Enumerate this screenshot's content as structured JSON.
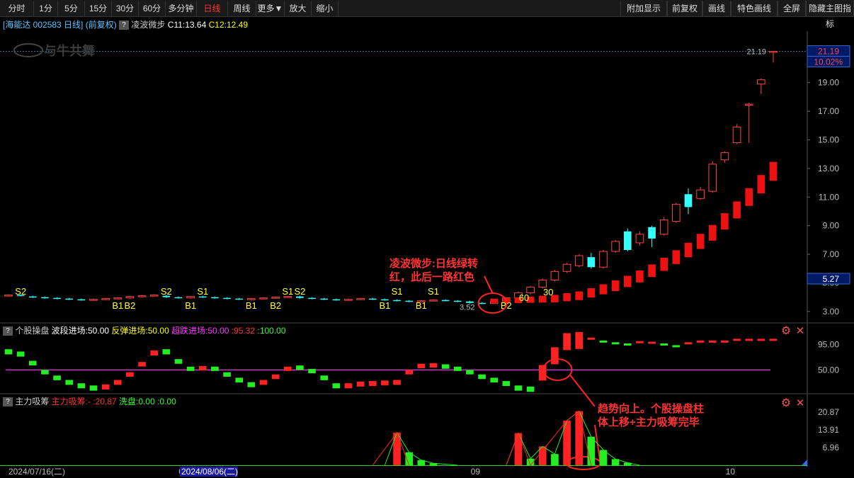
{
  "toolbar": {
    "left": [
      "分时",
      "1分",
      "5分",
      "15分",
      "30分",
      "60分",
      "多分钟",
      "日线",
      "周线",
      "更多▼",
      "放大",
      "缩小"
    ],
    "active": "日线",
    "right": [
      "附加显示",
      "前复权",
      "画线",
      "特色画线",
      "全屏",
      "隐藏主图指标"
    ]
  },
  "header": {
    "stock": "[海能达 002583 日线]",
    "adjust": "(前复权)",
    "indicator": "凌波微步",
    "c1": "C11:13.64",
    "c2": "C12:12.49"
  },
  "watermark": "与牛共舞",
  "panel2_header": {
    "name": "个股操盘",
    "items": [
      {
        "text": "波段进场:50.00",
        "color": "#ffffff"
      },
      {
        "text": "反弹进场:50.00",
        "color": "#ffff00"
      },
      {
        "text": "超跌进场:50.00",
        "color": "#ff33ff"
      },
      {
        "text": ":95.32",
        "color": "#ff3333"
      },
      {
        "text": ":100.00",
        "color": "#33ff33"
      }
    ]
  },
  "panel3_header": {
    "name": "主力吸筹",
    "items": [
      {
        "text": "主力吸筹:-",
        "color": "#ff3333"
      },
      {
        "text": ":20.87",
        "color": "#ff3333"
      },
      {
        "text": "洗盘:0.00",
        "color": "#33ff33"
      },
      {
        "text": ":0.00",
        "color": "#33ff33"
      }
    ]
  },
  "annotations": [
    {
      "text": "凌波微步:日线绿转",
      "color": "#ff3333"
    },
    {
      "text": "红，此后一路红色",
      "color": "#ff3333"
    },
    {
      "text": "趋势向上。个股操盘柱",
      "color": "#ff3333"
    },
    {
      "text": "体上移+主力吸筹完毕",
      "color": "#ff3333"
    }
  ],
  "signals": [
    "S2",
    "B1",
    "B2",
    "S2",
    "S1",
    "B1",
    "B1",
    "B2",
    "S1",
    "S2",
    "B1",
    "S1",
    "B1",
    "S1",
    "B2",
    "60",
    "30"
  ],
  "price_labels": {
    "high": "21.19",
    "low": "3.52",
    "last_tag": "21.19",
    "pct_tag": "10.02%",
    "ma_tag": "5.27"
  },
  "chart_data": {
    "type": "candlestick",
    "main": {
      "y_ticks": [
        "3.00",
        "5.00",
        "7.00",
        "9.00",
        "11.00",
        "13.00",
        "15.00",
        "17.00",
        "19.00",
        "21.00"
      ],
      "ylim": [
        2.2,
        22.6
      ],
      "candles": [
        [
          4.1,
          4.15,
          4.2,
          4.05
        ],
        [
          4.15,
          4.1,
          4.2,
          4.05
        ],
        [
          4.05,
          4.0,
          4.1,
          3.95
        ],
        [
          4.0,
          3.95,
          4.05,
          3.9
        ],
        [
          3.95,
          3.9,
          4.0,
          3.85
        ],
        [
          3.9,
          3.85,
          3.95,
          3.8
        ],
        [
          3.85,
          3.8,
          3.9,
          3.75
        ],
        [
          3.8,
          3.85,
          3.9,
          3.75
        ],
        [
          3.85,
          3.9,
          3.95,
          3.8
        ],
        [
          3.9,
          3.95,
          4.0,
          3.85
        ],
        [
          3.95,
          4.05,
          4.1,
          3.9
        ],
        [
          4.05,
          4.1,
          4.15,
          4.0
        ],
        [
          4.1,
          4.15,
          4.2,
          4.05
        ],
        [
          4.1,
          4.0,
          4.15,
          3.95
        ],
        [
          4.0,
          3.95,
          4.05,
          3.9
        ],
        [
          3.95,
          4.05,
          4.1,
          3.9
        ],
        [
          4.05,
          4.0,
          4.1,
          3.95
        ],
        [
          4.0,
          3.95,
          4.05,
          3.9
        ],
        [
          3.95,
          3.9,
          4.0,
          3.85
        ],
        [
          3.9,
          3.85,
          3.95,
          3.8
        ],
        [
          3.85,
          3.9,
          3.95,
          3.8
        ],
        [
          3.9,
          3.95,
          4.0,
          3.85
        ],
        [
          3.95,
          4.0,
          4.05,
          3.9
        ],
        [
          4.0,
          4.05,
          4.1,
          3.95
        ],
        [
          4.05,
          3.95,
          4.1,
          3.9
        ],
        [
          3.95,
          3.9,
          4.0,
          3.85
        ],
        [
          3.9,
          3.85,
          3.95,
          3.8
        ],
        [
          3.85,
          3.8,
          3.9,
          3.75
        ],
        [
          3.8,
          3.85,
          3.9,
          3.75
        ],
        [
          3.85,
          3.9,
          3.95,
          3.8
        ],
        [
          3.9,
          3.85,
          3.95,
          3.8
        ],
        [
          3.85,
          3.8,
          3.9,
          3.75
        ],
        [
          3.8,
          3.75,
          3.85,
          3.7
        ],
        [
          3.75,
          3.7,
          3.8,
          3.65
        ],
        [
          3.7,
          3.75,
          3.8,
          3.65
        ],
        [
          3.75,
          3.8,
          3.85,
          3.7
        ],
        [
          3.8,
          3.75,
          3.85,
          3.7
        ],
        [
          3.75,
          3.7,
          3.8,
          3.65
        ],
        [
          3.7,
          3.6,
          3.75,
          3.55
        ],
        [
          3.6,
          3.55,
          3.65,
          3.52
        ],
        [
          3.55,
          3.7,
          3.75,
          3.52
        ],
        [
          3.7,
          3.95,
          4.0,
          3.65
        ],
        [
          3.95,
          4.3,
          4.4,
          3.9
        ],
        [
          4.3,
          4.7,
          4.8,
          4.2
        ],
        [
          4.7,
          5.2,
          5.3,
          4.6
        ],
        [
          5.2,
          5.8,
          5.9,
          5.1
        ],
        [
          5.8,
          6.3,
          6.4,
          5.7
        ],
        [
          6.2,
          6.9,
          7.0,
          6.1
        ],
        [
          6.8,
          6.1,
          7.1,
          6.0
        ],
        [
          6.1,
          7.2,
          7.3,
          6.0
        ],
        [
          7.2,
          7.9,
          8.0,
          7.1
        ],
        [
          8.6,
          7.3,
          8.8,
          7.2
        ],
        [
          7.8,
          8.4,
          8.6,
          7.6
        ],
        [
          8.9,
          8.1,
          9.0,
          7.5
        ],
        [
          8.4,
          9.4,
          9.6,
          8.3
        ],
        [
          9.3,
          10.5,
          10.6,
          9.2
        ],
        [
          11.2,
          10.3,
          11.6,
          9.8
        ],
        [
          10.9,
          11.5,
          11.7,
          10.8
        ],
        [
          11.4,
          13.3,
          13.5,
          11.3
        ],
        [
          13.6,
          14.1,
          14.2,
          13.4
        ],
        [
          14.8,
          15.9,
          16.1,
          14.7
        ],
        [
          17.5,
          17.5,
          17.6,
          14.8
        ],
        [
          18.9,
          19.2,
          19.3,
          18.2
        ],
        [
          21.19,
          21.19,
          21.19,
          20.4
        ]
      ],
      "dots": [
        3.75,
        3.76,
        3.78,
        3.82,
        3.86,
        3.9,
        4.0,
        4.1,
        4.3,
        4.55,
        4.8,
        5.1,
        5.45,
        5.85,
        6.3,
        6.8,
        7.3,
        7.9,
        8.5,
        9.3,
        10.1,
        11.0,
        11.9,
        12.8
      ]
    },
    "panel2": {
      "y_ticks": [
        "50.00",
        "95.00"
      ],
      "ylim": [
        8,
        108
      ],
      "line": 50,
      "bars": [
        [
          82,
          "g"
        ],
        [
          78,
          "g"
        ],
        [
          62,
          "g"
        ],
        [
          46,
          "g"
        ],
        [
          36,
          "g"
        ],
        [
          28,
          "g"
        ],
        [
          22,
          "g"
        ],
        [
          18,
          "g"
        ],
        [
          20,
          "r"
        ],
        [
          28,
          "r"
        ],
        [
          42,
          "r"
        ],
        [
          60,
          "r"
        ],
        [
          80,
          "r"
        ],
        [
          82,
          "g"
        ],
        [
          65,
          "g"
        ],
        [
          52,
          "g"
        ],
        [
          53,
          "r"
        ],
        [
          52,
          "g"
        ],
        [
          42,
          "g"
        ],
        [
          32,
          "g"
        ],
        [
          24,
          "g"
        ],
        [
          28,
          "r"
        ],
        [
          38,
          "r"
        ],
        [
          52,
          "r"
        ],
        [
          54,
          "g"
        ],
        [
          48,
          "g"
        ],
        [
          36,
          "g"
        ],
        [
          22,
          "g"
        ],
        [
          22,
          "r"
        ],
        [
          25,
          "r"
        ],
        [
          26,
          "r"
        ],
        [
          27,
          "r"
        ],
        [
          28,
          "r"
        ],
        [
          46,
          "r"
        ],
        [
          57,
          "r"
        ],
        [
          58,
          "r"
        ],
        [
          56,
          "g"
        ],
        [
          52,
          "g"
        ],
        [
          46,
          "g"
        ],
        [
          38,
          "g"
        ],
        [
          32,
          "g"
        ],
        [
          26,
          "g"
        ],
        [
          18,
          "g"
        ],
        [
          16,
          "g"
        ],
        [
          45,
          "r"
        ],
        [
          75,
          "r"
        ],
        [
          100,
          "r"
        ],
        [
          102,
          "r"
        ],
        [
          102,
          "r"
        ],
        [
          97,
          "g"
        ],
        [
          94,
          "g"
        ],
        [
          92,
          "g"
        ],
        [
          96,
          "r"
        ],
        [
          95,
          "r"
        ],
        [
          92,
          "g"
        ],
        [
          89,
          "g"
        ],
        [
          94,
          "r"
        ],
        [
          97,
          "r"
        ],
        [
          97,
          "r"
        ],
        [
          97,
          "r"
        ],
        [
          100,
          "r"
        ],
        [
          100,
          "r"
        ],
        [
          100,
          "r"
        ],
        [
          100,
          "r"
        ]
      ]
    },
    "panel3": {
      "y_ticks": [
        "6.96",
        "13.91",
        "20.87"
      ],
      "ylim": [
        0,
        23.6
      ],
      "bars": [
        0,
        0,
        0,
        0,
        0,
        0,
        0,
        0,
        0,
        0,
        0,
        0,
        0,
        0,
        0,
        0,
        0,
        0,
        0,
        0,
        0,
        0,
        0,
        0,
        0,
        0,
        0,
        0,
        0,
        0,
        0,
        0,
        12.8,
        5.1,
        2.0,
        0.8,
        0,
        0,
        0,
        0,
        0,
        0,
        12.6,
        2.6,
        7.4,
        4.4,
        17.5,
        21.2,
        11.2,
        6.0,
        2.4,
        1.0,
        0,
        0,
        0,
        0,
        0,
        0,
        0,
        0,
        0,
        0,
        0,
        0
      ]
    },
    "x_ticks": [
      "2024/07/16(二)",
      "08",
      "2024/08/06(二)",
      "09",
      "10"
    ]
  }
}
